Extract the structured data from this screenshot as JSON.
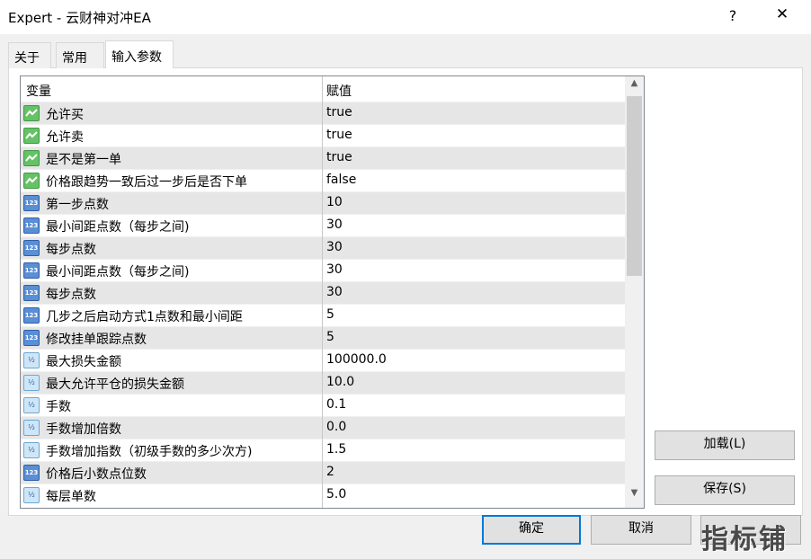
{
  "window": {
    "title": "Expert - 云财神对冲EA",
    "help_label": "?",
    "close_label": "✕"
  },
  "tabs": [
    {
      "label": "关于"
    },
    {
      "label": "常用"
    },
    {
      "label": "输入参数"
    }
  ],
  "table": {
    "headers": {
      "variable": "变量",
      "value": "赋值"
    },
    "rows": [
      {
        "icon": "bool-icon",
        "name": "允许买",
        "value": "true"
      },
      {
        "icon": "bool-icon",
        "name": "允许卖",
        "value": "true"
      },
      {
        "icon": "bool-icon",
        "name": "是不是第一单",
        "value": "true"
      },
      {
        "icon": "bool-icon",
        "name": "价格跟趋势一致后过一步后是否下单",
        "value": "false"
      },
      {
        "icon": "int-icon",
        "name": "第一步点数",
        "value": "10"
      },
      {
        "icon": "int-icon",
        "name": "最小间距点数（每步之间)",
        "value": "30"
      },
      {
        "icon": "int-icon",
        "name": "每步点数",
        "value": "30"
      },
      {
        "icon": "int-icon",
        "name": "最小间距点数（每步之间)",
        "value": "30"
      },
      {
        "icon": "int-icon",
        "name": "每步点数",
        "value": "30"
      },
      {
        "icon": "int-icon",
        "name": "几步之后启动方式1点数和最小间距",
        "value": "5"
      },
      {
        "icon": "int-icon",
        "name": "修改挂单跟踪点数",
        "value": "5"
      },
      {
        "icon": "double-icon",
        "name": "最大损失金额",
        "value": "100000.0"
      },
      {
        "icon": "double-icon",
        "name": "最大允许平仓的损失金额",
        "value": "10.0"
      },
      {
        "icon": "double-icon",
        "name": "手数",
        "value": "0.1"
      },
      {
        "icon": "double-icon",
        "name": "手数增加倍数",
        "value": "0.0"
      },
      {
        "icon": "double-icon",
        "name": "手数增加指数（初级手数的多少次方)",
        "value": "1.5"
      },
      {
        "icon": "int-icon",
        "name": "价格后小数点位数",
        "value": "2"
      },
      {
        "icon": "double-icon",
        "name": "每层单数",
        "value": "5.0"
      }
    ]
  },
  "icon_glyphs": {
    "int": "123",
    "double": "½"
  },
  "buttons": {
    "load": "加载(L)",
    "save": "保存(S)",
    "ok": "确定",
    "cancel": "取消"
  },
  "watermark": "指标铺"
}
